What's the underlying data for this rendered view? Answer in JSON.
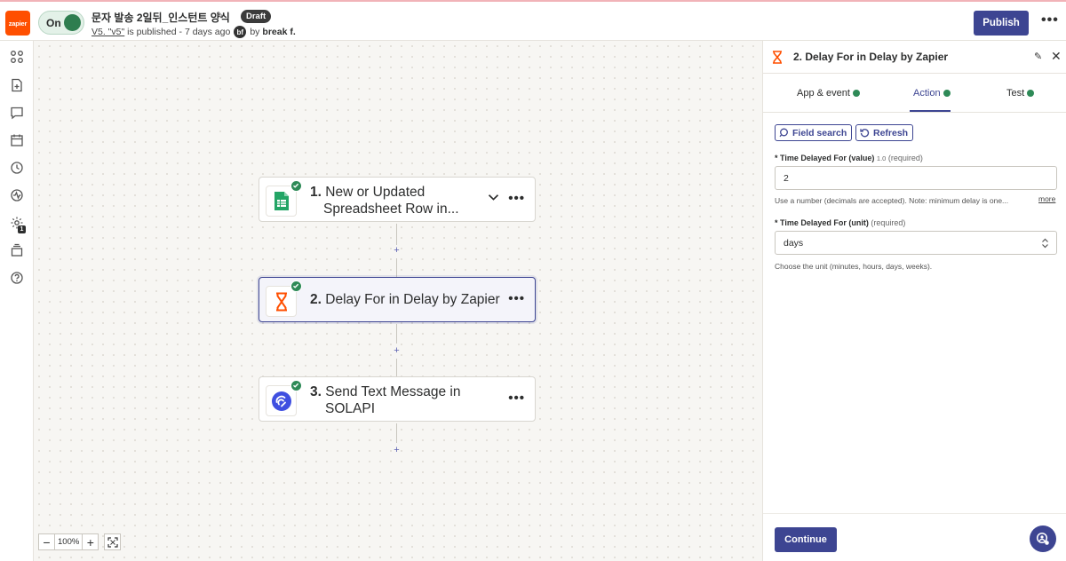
{
  "app": {
    "logo_text": "zapier",
    "toggle_label": "On",
    "zap_title": "문자 발송 2일뒤_인스턴트 양식",
    "draft_badge": "Draft",
    "version_link": "V5. \"v5\"",
    "published_text": "is published - 7 days ago",
    "author_initials": "bf",
    "by_text": "by",
    "author_name": "break f.",
    "publish_label": "Publish",
    "more_icon": "more-horizontal-icon"
  },
  "left_rail": {
    "icons": [
      "apps-icon",
      "file-add-icon",
      "comment-icon",
      "calendar-icon",
      "history-icon",
      "status-icon",
      "settings-icon",
      "layers-icon",
      "help-icon"
    ],
    "status_badge": "1"
  },
  "steps": [
    {
      "number": "1.",
      "title_line1": "New or Updated",
      "title_line2": "Spreadsheet Row in...",
      "app": "google-sheets-icon",
      "status": "complete",
      "has_chevron": true
    },
    {
      "number": "2.",
      "title_line1": "Delay For in Delay by Zapier",
      "title_line2": "",
      "app": "delay-hourglass-icon",
      "status": "complete",
      "selected": true
    },
    {
      "number": "3.",
      "title_line1": "Send Text Message in",
      "title_line2": "SOLAPI",
      "app": "solapi-icon",
      "status": "complete"
    }
  ],
  "zoom": {
    "minus": "−",
    "value": "100%",
    "plus": "+"
  },
  "panel": {
    "title": "2. Delay For in Delay by Zapier",
    "tabs": [
      {
        "label": "App & event",
        "done": true
      },
      {
        "label": "Action",
        "done": true,
        "active": true
      },
      {
        "label": "Test",
        "done": true
      }
    ],
    "field_search_label": "Field search",
    "refresh_label": "Refresh",
    "fields": [
      {
        "asterisk": "*",
        "label": "Time Delayed For (value)",
        "version": "1.0",
        "required": "(required)",
        "value": "2",
        "help": "Use a number (decimals are accepted). Note: minimum delay is one...",
        "more": "more"
      },
      {
        "asterisk": "*",
        "label": "Time Delayed For (unit)",
        "required": "(required)",
        "value": "days",
        "help": "Choose the unit (minutes, hours, days, weeks)."
      }
    ],
    "continue_label": "Continue"
  },
  "colors": {
    "brand": "#ff4f00",
    "primary": "#3d4592",
    "success": "#2e8a57"
  }
}
